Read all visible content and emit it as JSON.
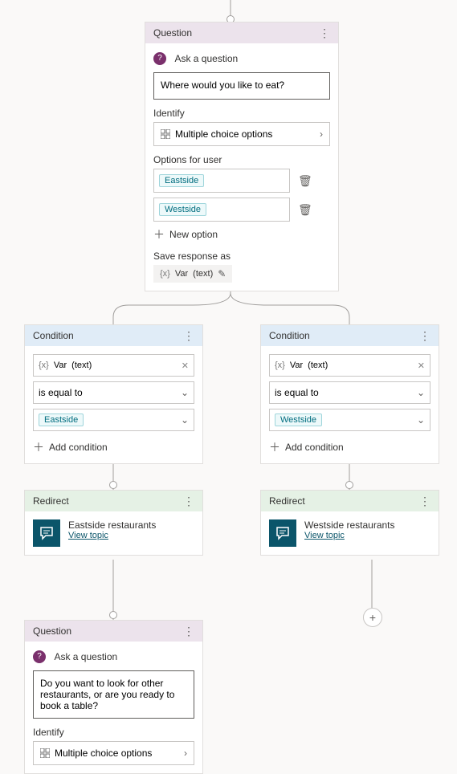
{
  "question1": {
    "header": "Question",
    "ask_label": "Ask a question",
    "prompt": "Where would you like to eat?",
    "identify_label": "Identify",
    "identify_value": "Multiple choice options",
    "options_label": "Options for user",
    "options": [
      "Eastside",
      "Westside"
    ],
    "new_option": "New option",
    "save_label": "Save response as",
    "var_name": "Var",
    "var_type": "(text)"
  },
  "condition1": {
    "header": "Condition",
    "var_name": "Var",
    "var_type": "(text)",
    "operator": "is equal to",
    "value": "Eastside",
    "add_label": "Add condition"
  },
  "condition2": {
    "header": "Condition",
    "var_name": "Var",
    "var_type": "(text)",
    "operator": "is equal to",
    "value": "Westside",
    "add_label": "Add condition"
  },
  "redirect1": {
    "header": "Redirect",
    "title": "Eastside restaurants",
    "link": "View topic"
  },
  "redirect2": {
    "header": "Redirect",
    "title": "Westside restaurants",
    "link": "View topic"
  },
  "question2": {
    "header": "Question",
    "ask_label": "Ask a question",
    "prompt": "Do you want to look for other restaurants, or are you ready to book a table?",
    "identify_label": "Identify",
    "identify_value": "Multiple choice options"
  }
}
